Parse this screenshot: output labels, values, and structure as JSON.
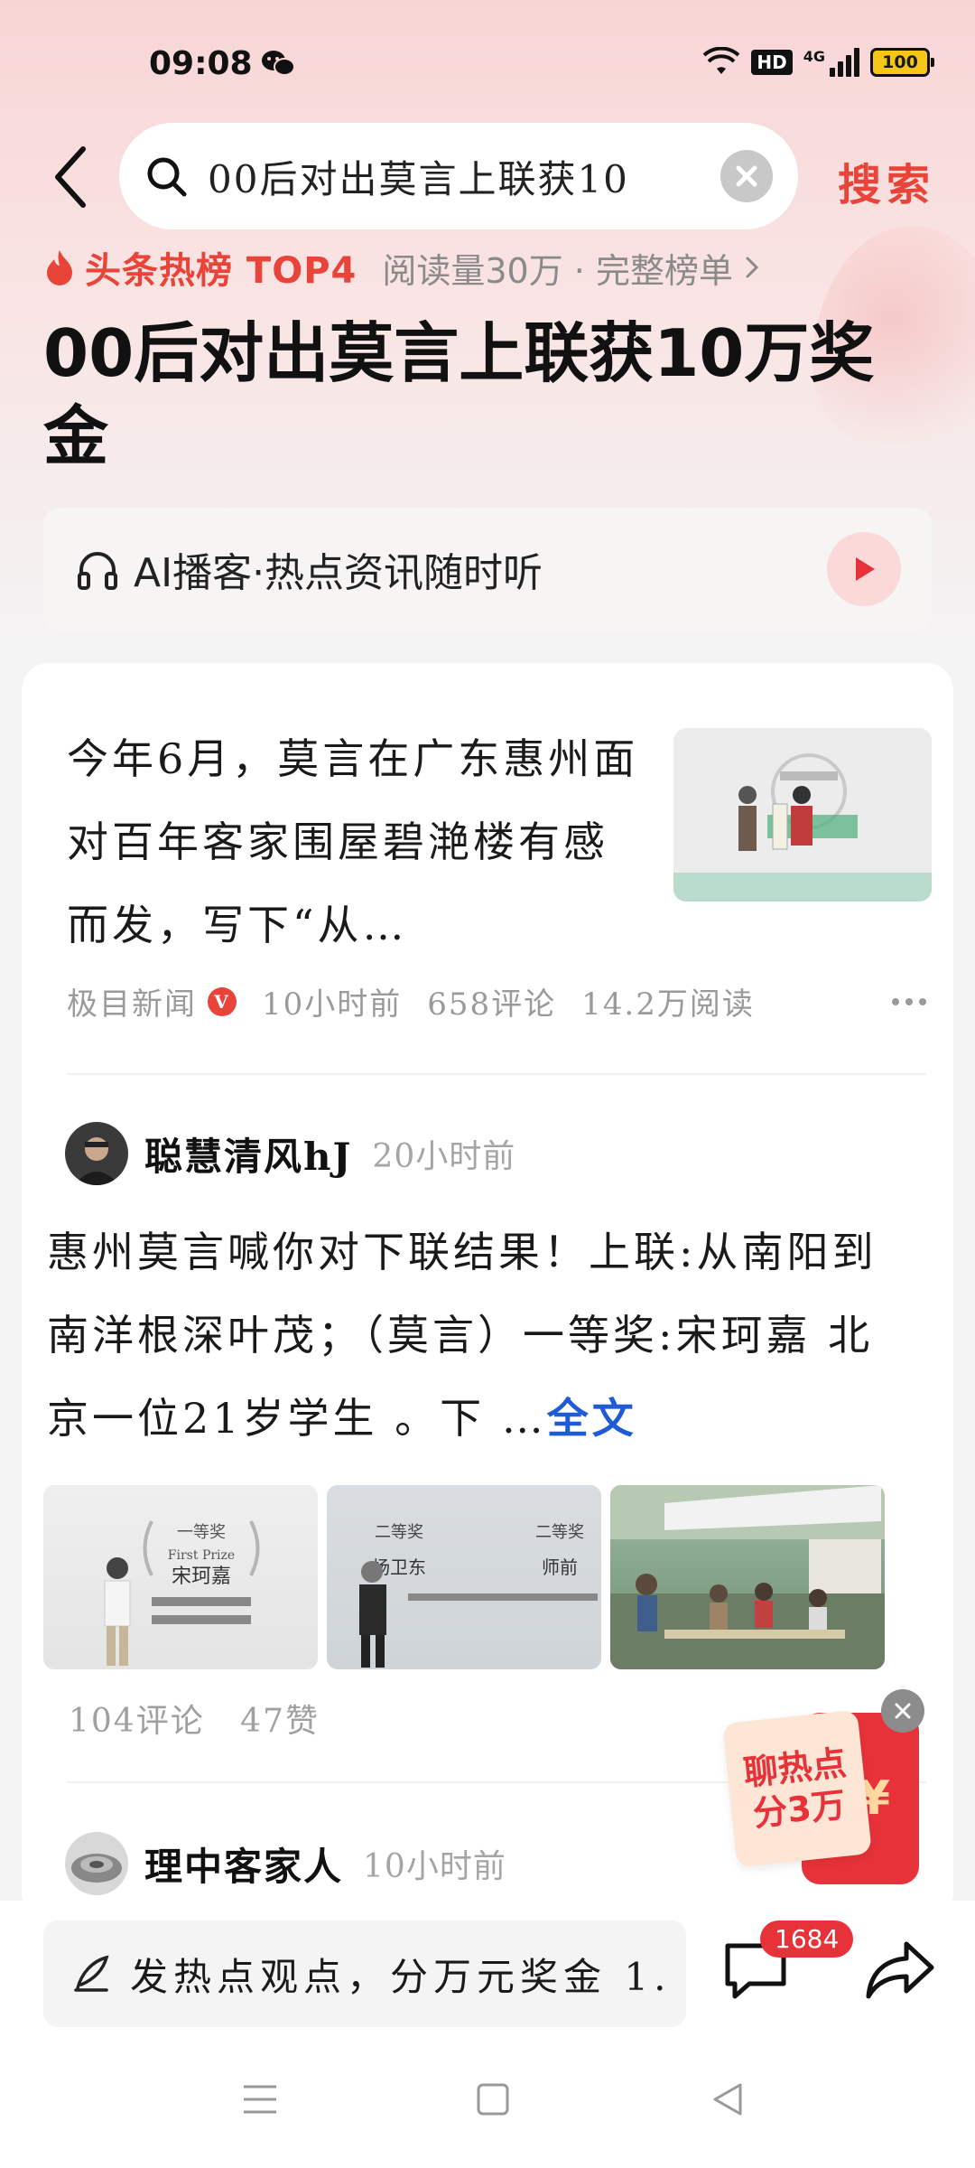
{
  "status_bar": {
    "time": "09:08",
    "hd_label": "HD",
    "network_label": "4G",
    "battery": "100"
  },
  "search": {
    "query": "00后对出莫言上联获10",
    "action_label": "搜索"
  },
  "hot_banner": {
    "label": "头条热榜 TOP4",
    "meta": "阅读量30万 · 完整榜单",
    "headline": "00后对出莫言上联获10万奖金"
  },
  "podcast": {
    "label": "AI播客·热点资讯随时听"
  },
  "article": {
    "text": "今年6月，莫言在广东惠州面对百年客家围屋碧滟楼有感而发，写下“从…",
    "source": "极目新闻",
    "verified_badge": "V",
    "time": "10小时前",
    "comments": "658评论",
    "reads": "14.2万阅读"
  },
  "post1": {
    "author": "聪慧清风hJ",
    "time": "20小时前",
    "text": "惠州莫言喊你对下联结果！上联:从南阳到南洋根深叶茂；（莫言）一等奖:宋珂嘉 北京一位21岁学生 。下",
    "fulltext_label": "全文",
    "comments": "104评论",
    "likes": "47赞",
    "images": [
      {
        "caption": "一等奖 First Prize 宋珂嘉"
      },
      {
        "caption": "二等奖 Second Prize 杨卫东"
      },
      {
        "caption": ""
      }
    ]
  },
  "post2": {
    "author": "理中客家人",
    "time": "10小时前"
  },
  "promo": {
    "text": "聊热点 分3万",
    "symbol": "¥"
  },
  "bottom_bar": {
    "comment_placeholder": "发热点观点，分万元奖金 1.",
    "comment_count": "1684"
  },
  "colors": {
    "accent_red": "#e8443a",
    "link_blue": "#1e5bd6"
  },
  "icons": [
    "back-icon",
    "search-icon",
    "clear-icon",
    "headphones-icon",
    "play-icon",
    "flame-icon",
    "chevron-right-icon",
    "more-icon",
    "pen-icon",
    "comment-icon",
    "share-icon",
    "menu-icon",
    "home-icon",
    "back-nav-icon"
  ]
}
